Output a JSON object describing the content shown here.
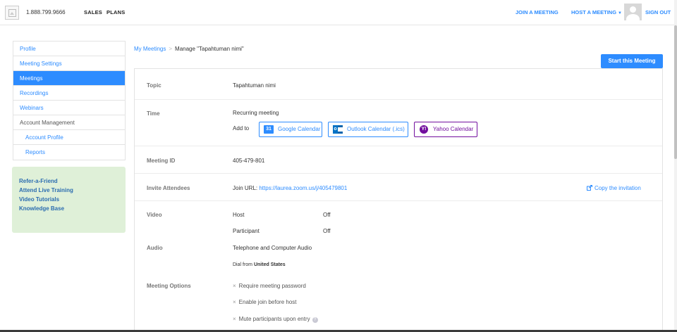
{
  "topnav": {
    "phone": "1.888.799.9666",
    "sales": "SALES",
    "plans": "PLANS",
    "join": "JOIN A MEETING",
    "host": "HOST A MEETING",
    "signout": "SIGN OUT"
  },
  "sidebar": {
    "items": [
      {
        "label": "Profile"
      },
      {
        "label": "Meeting Settings"
      },
      {
        "label": "Meetings"
      },
      {
        "label": "Recordings"
      },
      {
        "label": "Webinars"
      },
      {
        "label": "Account Management"
      },
      {
        "label": "Account Profile"
      },
      {
        "label": "Reports"
      }
    ],
    "learn": [
      "Refer-a-Friend",
      "Attend Live Training",
      "Video Tutorials",
      "Knowledge Base"
    ]
  },
  "breadcrumb": {
    "parent": "My Meetings",
    "separator": ">",
    "current": "Manage \"Tapahtuman nimi\""
  },
  "start_button": "Start this Meeting",
  "details": {
    "topic_label": "Topic",
    "topic_value": "Tapahtuman nimi",
    "time_label": "Time",
    "time_value": "Recurring meeting",
    "add_to": "Add to",
    "google_cal": "Google Calendar",
    "google_cal_icon_text": "31",
    "outlook_cal": "Outlook Calendar (.ics)",
    "outlook_icon_text": "o",
    "yahoo_cal": "Yahoo Calendar",
    "yahoo_icon_text": "Y!",
    "meeting_id_label": "Meeting ID",
    "meeting_id_value": "405-479-801",
    "invite_label": "Invite Attendees",
    "join_url_prefix": "Join URL:",
    "join_url": "https://laurea.zoom.us/j/405479801",
    "copy_invitation": "Copy the invitation",
    "video_label": "Video",
    "host_label": "Host",
    "host_value": "Off",
    "participant_label": "Participant",
    "participant_value": "Off",
    "audio_label": "Audio",
    "audio_value": "Telephone and Computer Audio",
    "dial_from_prefix": "Dial from",
    "dial_from_country": "United States",
    "options_label": "Meeting Options",
    "options": [
      "Require meeting password",
      "Enable join before host",
      "Mute participants upon entry"
    ],
    "option_mark": "×",
    "help_mark": "?"
  },
  "colors": {
    "accent": "#2d8cff",
    "learn_bg": "#dff0d8",
    "yahoo": "#720e9e"
  }
}
